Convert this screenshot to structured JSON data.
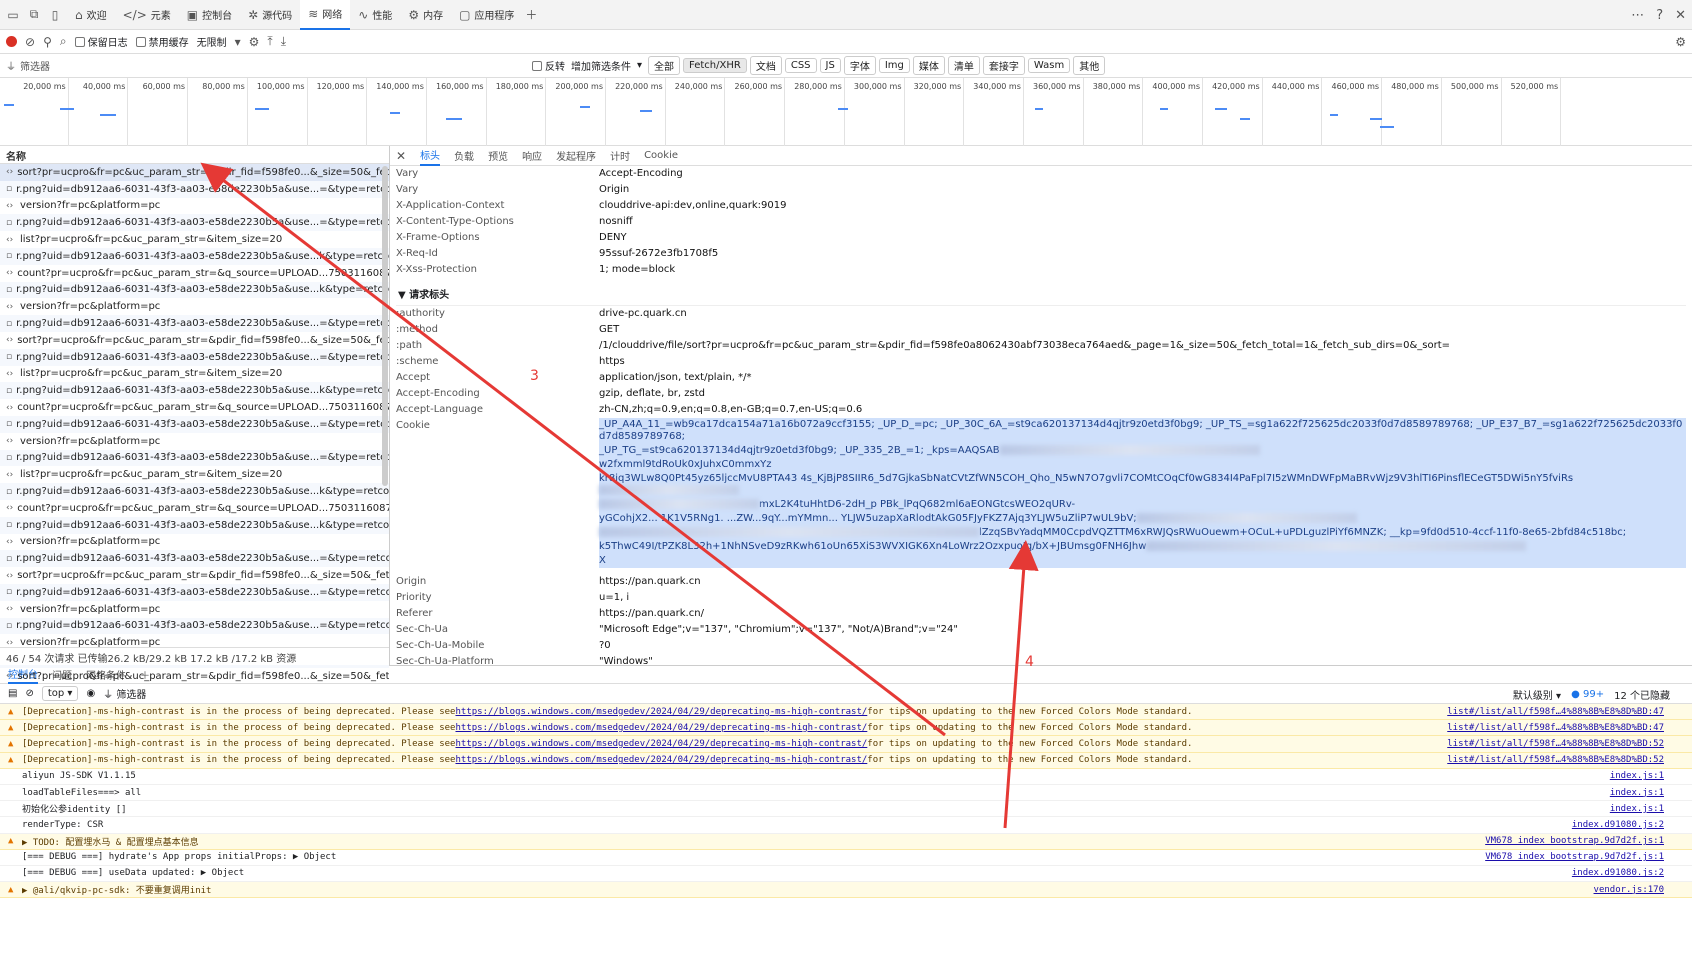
{
  "top_tabs": [
    {
      "icon": "home-icon",
      "label": "欢迎"
    },
    {
      "icon": "code-icon",
      "label": "元素"
    },
    {
      "icon": "console-icon",
      "label": "控制台"
    },
    {
      "icon": "bug-icon",
      "label": "源代码"
    },
    {
      "icon": "wifi-icon",
      "label": "网络",
      "active": true
    },
    {
      "icon": "pulse-icon",
      "label": "性能"
    },
    {
      "icon": "gear-icon",
      "label": "内存"
    },
    {
      "icon": "app-icon",
      "label": "应用程序"
    }
  ],
  "toolbar": {
    "preserve_log": "保留日志",
    "disable_cache": "禁用缓存",
    "throttle": "无限制"
  },
  "filter": {
    "placeholder": "筛选器",
    "invert": "反转",
    "more": "增加筛选条件",
    "types": [
      "全部",
      "Fetch/XHR",
      "文档",
      "CSS",
      "JS",
      "字体",
      "Img",
      "媒体",
      "清单",
      "套接字",
      "Wasm",
      "其他"
    ],
    "active_type": "Fetch/XHR"
  },
  "timeline_ticks": [
    "20,000 ms",
    "40,000 ms",
    "60,000 ms",
    "80,000 ms",
    "100,000 ms",
    "120,000 ms",
    "140,000 ms",
    "160,000 ms",
    "180,000 ms",
    "200,000 ms",
    "220,000 ms",
    "240,000 ms",
    "260,000 ms",
    "280,000 ms",
    "300,000 ms",
    "320,000 ms",
    "340,000 ms",
    "360,000 ms",
    "380,000 ms",
    "400,000 ms",
    "420,000 ms",
    "440,000 ms",
    "460,000 ms",
    "480,000 ms",
    "500,000 ms",
    "520,000 ms"
  ],
  "requests_header": "名称",
  "requests": [
    "sort?pr=ucpro&fr=pc&uc_param_str=&pdir_fid=f598fe0...&_size=50&_fetc...",
    "r.png?uid=db912aa6-6031-43f3-aa03-e58de2230b5a&use...=&type=retcod...",
    "version?fr=pc&platform=pc",
    "r.png?uid=db912aa6-6031-43f3-aa03-e58de2230b5a&use...=&type=retcod...",
    "list?pr=ucpro&fr=pc&uc_param_str=&item_size=20",
    "r.png?uid=db912aa6-6031-43f3-aa03-e58de2230b5a&use...k&type=retcod...",
    "count?pr=ucpro&fr=pc&uc_param_str=&q_source=UPLOAD...75031160873...",
    "r.png?uid=db912aa6-6031-43f3-aa03-e58de2230b5a&use...k&type=retcod...",
    "version?fr=pc&platform=pc",
    "r.png?uid=db912aa6-6031-43f3-aa03-e58de2230b5a&use...=&type=retcod...",
    "sort?pr=ucpro&fr=pc&uc_param_str=&pdir_fid=f598fe0...&_size=50&_fetc...",
    "r.png?uid=db912aa6-6031-43f3-aa03-e58de2230b5a&use...=&type=retcod...",
    "list?pr=ucpro&fr=pc&uc_param_str=&item_size=20",
    "r.png?uid=db912aa6-6031-43f3-aa03-e58de2230b5a&use...k&type=retcod...",
    "count?pr=ucpro&fr=pc&uc_param_str=&q_source=UPLOAD...75031160873...",
    "r.png?uid=db912aa6-6031-43f3-aa03-e58de2230b5a&use...=&type=retcod...",
    "version?fr=pc&platform=pc",
    "r.png?uid=db912aa6-6031-43f3-aa03-e58de2230b5a&use...=&type=retcod...",
    "list?pr=ucpro&fr=pc&uc_param_str=&item_size=20",
    "r.png?uid=db912aa6-6031-43f3-aa03-e58de2230b5a&use...k&type=retcod...",
    "count?pr=ucpro&fr=pc&uc_param_str=&q_source=UPLOAD...75031160873...",
    "r.png?uid=db912aa6-6031-43f3-aa03-e58de2230b5a&use...k&type=retcod...",
    "version?fr=pc&platform=pc",
    "r.png?uid=db912aa6-6031-43f3-aa03-e58de2230b5a&use...=&type=retcod...",
    "sort?pr=ucpro&fr=pc&uc_param_str=&pdir_fid=f598fe0...&_size=50&_fetc...",
    "r.png?uid=db912aa6-6031-43f3-aa03-e58de2230b5a&use...=&type=retcod...",
    "version?fr=pc&platform=pc",
    "r.png?uid=db912aa6-6031-43f3-aa03-e58de2230b5a&use...=&type=retcod...",
    "version?fr=pc&platform=pc",
    "r.png?uid=db912aa6-6031-43f3-aa03-e58de2230b5a&use...=&type=retcod...",
    "sort?pr=ucpro&fr=pc&uc_param_str=&pdir_fid=f598fe0...&_size=50&_fetc..."
  ],
  "status": "46 / 54 次请求   已传输26.2 kB/29.2 kB   17.2 kB /17.2 kB 资源",
  "detail_tabs": [
    "标头",
    "负载",
    "预览",
    "响应",
    "发起程序",
    "计时",
    "Cookie"
  ],
  "response_headers": [
    [
      "Vary",
      "Accept-Encoding"
    ],
    [
      "Vary",
      "Origin"
    ],
    [
      "X-Application-Context",
      "clouddrive-api:dev,online,quark:9019"
    ],
    [
      "X-Content-Type-Options",
      "nosniff"
    ],
    [
      "X-Frame-Options",
      "DENY"
    ],
    [
      "X-Req-Id",
      "95ssuf-2672e3fb1708f5"
    ],
    [
      "X-Xss-Protection",
      "1; mode=block"
    ]
  ],
  "request_headers_title": "▼ 请求标头",
  "request_headers_a": [
    [
      ":authority",
      "drive-pc.quark.cn"
    ],
    [
      ":method",
      "GET"
    ],
    [
      ":path",
      "/1/clouddrive/file/sort?pr=ucpro&fr=pc&uc_param_str=&pdir_fid=f598fe0a8062430abf73038eca764aed&_page=1&_size=50&_fetch_total=1&_fetch_sub_dirs=0&_sort="
    ],
    [
      ":scheme",
      "https"
    ],
    [
      "Accept",
      "application/json, text/plain, */*"
    ],
    [
      "Accept-Encoding",
      "gzip, deflate, br, zstd"
    ],
    [
      "Accept-Language",
      "zh-CN,zh;q=0.9,en;q=0.8,en-GB;q=0.7,en-US;q=0.6"
    ]
  ],
  "cookie_label": "Cookie",
  "cookie_lines": [
    "_UP_A4A_11_=wb9ca17dca154a71a16b072a9ccf3155; _UP_D_=pc; _UP_30C_6A_=st9ca620137134d4qjtr9z0etd3f0bg9; _UP_TS_=sg1a622f725625dc2033f0d7d8589789768; _UP_E37_B7_=sg1a622f725625dc2033f0d7d8589789768;",
    "_UP_TG_=st9ca620137134d4qjtr9z0etd3f0bg9; _UP_335_2B_=1; _kps=AAQSAB",
    "w2fxmml9tdRoUk0xJuhxC0mmxYz",
    "kr8iq3WLw8Q0Pt45yz65ljccMvU8PTA43 4s_KjBjP8SIIR6_5d7GjkaSbNatCVtZfWN5COH_Qho_N5wN7O7gvli7COMtCOqCf0wG834I4PaFpl7I5zWMnDWFpMaBRvWjz9V3hlTI6PinsflECeGT5DWi5nY5fviRs",
    "mxL2K4tuHhtD6-2dH_p PBk_lPqQ682ml6aEONGtcsWEO2qURv-",
    "yGCohjX2... 1K1V5RNg1. ...ZW...9qY...mYMmn... YLJW5uzapXaRlodtAkG05FJyFKZ7Ajq3YLJW5uZliP7wUL9bV;",
    "lZzqSBvYadqMM0CcpdVQZTTM6xRWJQsRWuOuewm+OCuL+uPDLguzlPiYf6MNZK; __kp=9fd0d510-4ccf-11f0-8e65-2bfd84c518bc;",
    "k5ThwC49I/tPZK8L32h+1NhNSveD9zRKwh61oUn65XiS3WVXIGK6Xn4LoWrz2OzxpuoJq/bX+JBUmsg0FNH6Jhw",
    "X"
  ],
  "request_headers_b": [
    [
      "Origin",
      "https://pan.quark.cn"
    ],
    [
      "Priority",
      "u=1, i"
    ],
    [
      "Referer",
      "https://pan.quark.cn/"
    ],
    [
      "Sec-Ch-Ua",
      "\"Microsoft Edge\";v=\"137\", \"Chromium\";v=\"137\", \"Not/A)Brand\";v=\"24\""
    ],
    [
      "Sec-Ch-Ua-Mobile",
      "?0"
    ],
    [
      "Sec-Ch-Ua-Platform",
      "\"Windows\""
    ],
    [
      "Sec-Fetch-Dest",
      "empty"
    ],
    [
      "Sec-Fetch-Mode",
      "cors"
    ],
    [
      "Sec-Fetch-Site",
      "same-site"
    ]
  ],
  "console_tabs": [
    "控制台",
    "问题",
    "网络条件"
  ],
  "console_toolbar": {
    "context": "top",
    "filter": "筛选器",
    "levels": "默认级别",
    "badge": "99+",
    "hidden": "12 个已隐藏"
  },
  "logs": [
    {
      "warn": true,
      "pre": "[Deprecation]-ms-high-contrast is in the process of being deprecated. Please see ",
      "link": "https://blogs.windows.com/msedgedev/2024/04/29/deprecating-ms-high-contrast/",
      "post": " for tips on updating to the new Forced Colors Mode standard.",
      "src": "list#/list/all/f598f…4%88%8B%E8%8D%BD:47"
    },
    {
      "warn": true,
      "pre": "[Deprecation]-ms-high-contrast is in the process of being deprecated. Please see ",
      "link": "https://blogs.windows.com/msedgedev/2024/04/29/deprecating-ms-high-contrast/",
      "post": " for tips on updating to the new Forced Colors Mode standard.",
      "src": "list#/list/all/f598f…4%88%8B%E8%8D%BD:47"
    },
    {
      "warn": true,
      "pre": "[Deprecation]-ms-high-contrast is in the process of being deprecated. Please see ",
      "link": "https://blogs.windows.com/msedgedev/2024/04/29/deprecating-ms-high-contrast/",
      "post": " for tips on updating to the new Forced Colors Mode standard.",
      "src": "list#/list/all/f598f…4%88%8B%E8%8D%BD:52"
    },
    {
      "warn": true,
      "pre": "[Deprecation]-ms-high-contrast is in the process of being deprecated. Please see ",
      "link": "https://blogs.windows.com/msedgedev/2024/04/29/deprecating-ms-high-contrast/",
      "post": " for tips on updating to the new Forced Colors Mode standard.",
      "src": "list#/list/all/f598f…4%88%8B%E8%8D%BD:52"
    },
    {
      "warn": false,
      "pre": "aliyun JS-SDK V1.1.15",
      "link": "",
      "post": "",
      "src": "index.js:1"
    },
    {
      "warn": false,
      "pre": "loadTableFiles===> all",
      "link": "",
      "post": "",
      "src": "index.js:1"
    },
    {
      "warn": false,
      "pre": "初始化公参identity []",
      "link": "",
      "post": "",
      "src": "index.js:1"
    },
    {
      "warn": false,
      "pre": "renderType: CSR",
      "link": "",
      "post": "",
      "src": "index.d91080.js:2"
    },
    {
      "warn": true,
      "pre": "▶ TODO: 配置埋水马 & 配置埋点基本信息",
      "link": "",
      "post": "",
      "src": "VM678 index_bootstrap.9d7d2f.js:1"
    },
    {
      "warn": false,
      "pre": "[=== DEBUG ===] hydrate's App props initialProps:  ▶ Object",
      "link": "",
      "post": "",
      "src": "VM678 index_bootstrap.9d7d2f.js:1"
    },
    {
      "warn": false,
      "pre": "[=== DEBUG ===] useData updated:  ▶ Object",
      "link": "",
      "post": "",
      "src": "index.d91080.js:2"
    },
    {
      "warn": true,
      "pre": "▶ @ali/qkvip-pc-sdk:  不要重复调用init",
      "link": "",
      "post": "",
      "src": "vendor.js:170"
    }
  ],
  "annotations": {
    "a3": "3",
    "a4": "4",
    "color": "#e53935"
  }
}
